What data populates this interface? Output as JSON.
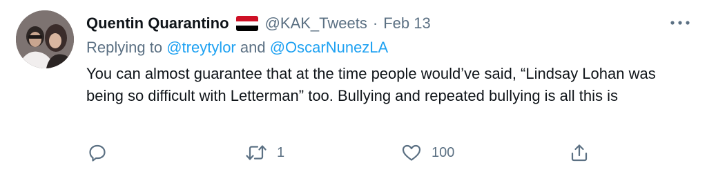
{
  "tweet": {
    "display_name": "Quentin Quarantino",
    "handle": "@KAK_Tweets",
    "separator": "·",
    "date": "Feb 13",
    "reply_prefix": "Replying to ",
    "reply_user_1": "@treytylor",
    "reply_joiner": " and ",
    "reply_user_2": "@OscarNunezLA",
    "text": "You can almost guarantee that at the time people would’ve said, “Lindsay Lohan was being so difficult with Letterman” too. Bullying and repeated bullying is all this is",
    "icons": {
      "more": "more-horizontal-icon",
      "flag": "flag-icon",
      "reply": "reply-icon",
      "retweet": "retweet-icon",
      "like": "heart-icon",
      "share": "share-icon"
    },
    "actions": {
      "reply_count": "",
      "retweet_count": "1",
      "like_count": "100"
    },
    "colors": {
      "text": "#0f1419",
      "secondary": "#5b7083",
      "link": "#1da1f2",
      "flag_red": "#ce1126",
      "flag_white": "#ffffff",
      "flag_black": "#000000"
    }
  }
}
